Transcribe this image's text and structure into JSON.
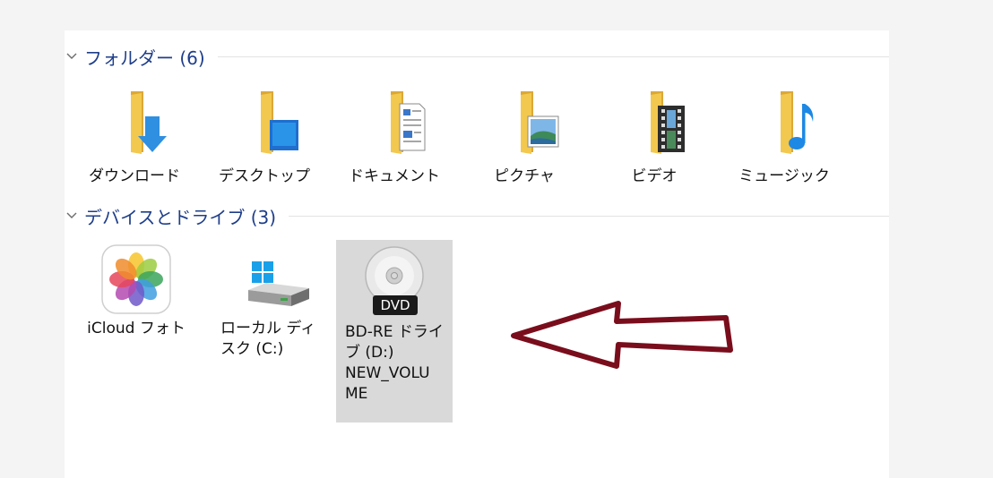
{
  "sections": [
    {
      "title": "フォルダー (6)"
    },
    {
      "title": "デバイスとドライブ (3)"
    }
  ],
  "folders": [
    {
      "label": "ダウンロード",
      "icon": "download-folder-icon"
    },
    {
      "label": "デスクトップ",
      "icon": "desktop-folder-icon"
    },
    {
      "label": "ドキュメント",
      "icon": "documents-folder-icon"
    },
    {
      "label": "ピクチャ",
      "icon": "pictures-folder-icon"
    },
    {
      "label": "ビデオ",
      "icon": "videos-folder-icon"
    },
    {
      "label": "ミュージック",
      "icon": "music-folder-icon"
    }
  ],
  "drives": [
    {
      "label_lines": [
        "iCloud フォト"
      ],
      "icon": "icloud-photos-icon"
    },
    {
      "label_lines": [
        "ローカル ディ",
        "スク (C:)"
      ],
      "icon": "hard-drive-icon"
    },
    {
      "label_lines": [
        "BD-RE ドライ",
        "ブ (D:)",
        "NEW_VOLU",
        "ME"
      ],
      "icon": "dvd-drive-icon",
      "badge": "DVD",
      "selected": true
    }
  ],
  "colors": {
    "header_text": "#1e3e8a",
    "folder": "#f3c84e",
    "selection": "#d9d9d9",
    "arrow": "#7a0d1c"
  }
}
